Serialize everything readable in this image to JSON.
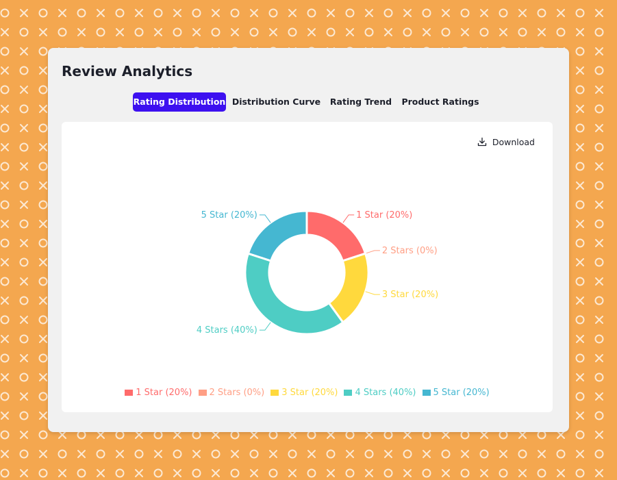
{
  "title": "Review Analytics",
  "tabs": [
    {
      "label": "Rating Distribution",
      "active": true
    },
    {
      "label": "Distribution Curve",
      "active": false
    },
    {
      "label": "Rating Trend",
      "active": false
    },
    {
      "label": "Product Ratings",
      "active": false
    }
  ],
  "download_label": "Download",
  "colors": {
    "accent": "#3d10f0",
    "background": "#f4a74f"
  },
  "chart_data": {
    "type": "pie",
    "donut": true,
    "categories": [
      "1 Star",
      "2 Stars",
      "3 Star",
      "4 Stars",
      "5 Star"
    ],
    "values": [
      20,
      0,
      20,
      40,
      20
    ],
    "labels": [
      "1 Star (20%)",
      "2 Stars (0%)",
      "3 Star (20%)",
      "4 Stars (40%)",
      "5 Star (20%)"
    ],
    "colors": [
      "#ff6b6b",
      "#ff9f85",
      "#ffd93d",
      "#4ecdc4",
      "#45b7d1"
    ],
    "legend": "bottom"
  }
}
